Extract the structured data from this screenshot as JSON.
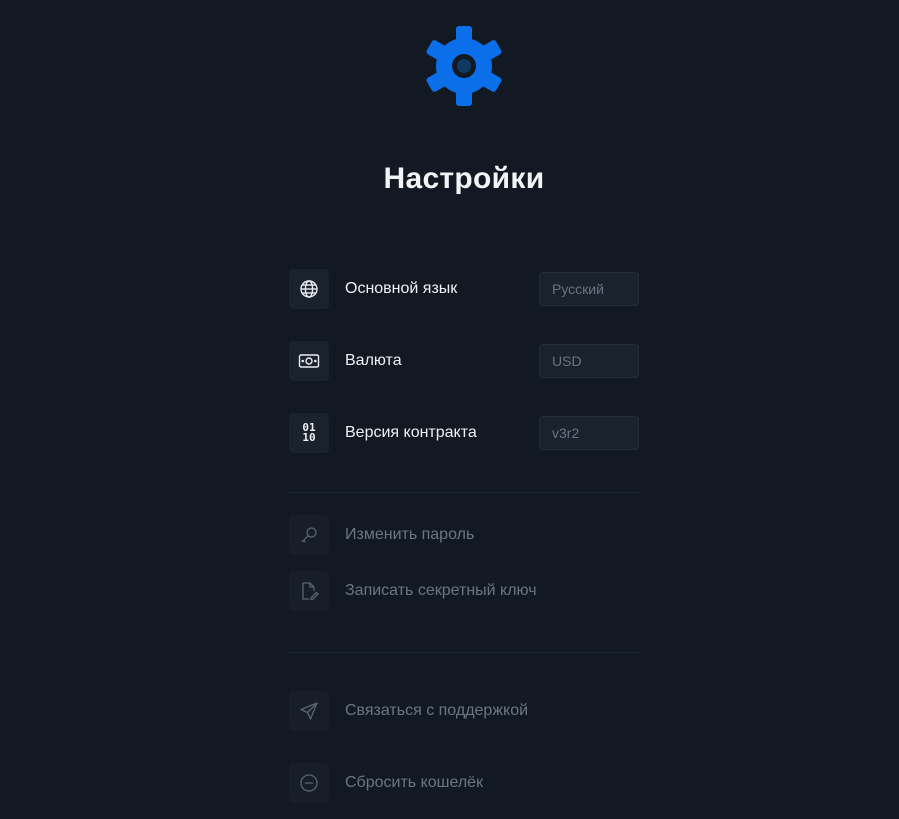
{
  "header": {
    "icon": "gear-icon",
    "title": "Настройки"
  },
  "settings": [
    {
      "icon": "globe-icon",
      "label": "Основной язык",
      "placeholder": "Русский"
    },
    {
      "icon": "banknote-icon",
      "label": "Валюта",
      "placeholder": "USD"
    },
    {
      "icon": "binary-icon",
      "label": "Версия контракта",
      "placeholder": "v3r2",
      "icon_text": [
        "01",
        "10"
      ]
    }
  ],
  "security": [
    {
      "icon": "key-icon",
      "label": "Изменить пароль"
    },
    {
      "icon": "document-pen-icon",
      "label": "Записать секретный ключ"
    }
  ],
  "other": [
    {
      "icon": "paper-plane-icon",
      "label": "Связаться с поддержкой"
    },
    {
      "icon": "minus-circle-icon",
      "label": "Сбросить кошелёк"
    }
  ],
  "colors": {
    "background": "#121922",
    "accent": "#0a6fe8",
    "text": "#eef1f5",
    "muted": "#6c7582"
  }
}
